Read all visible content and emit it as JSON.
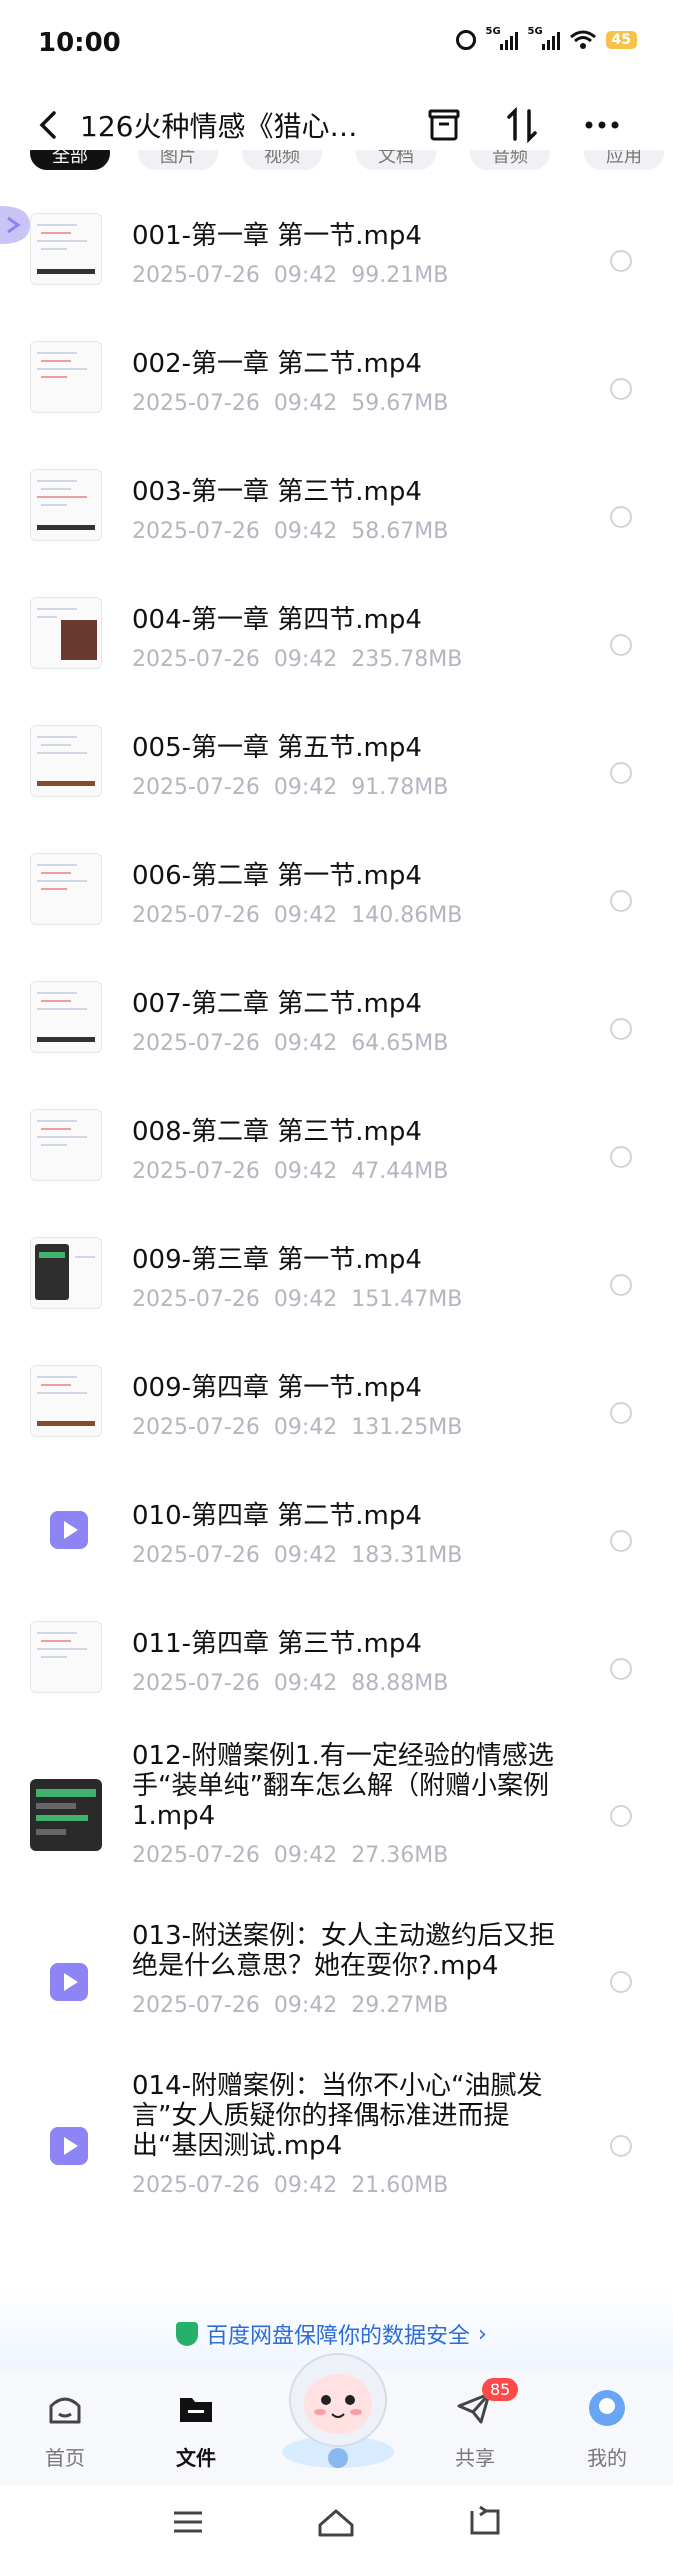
{
  "status": {
    "time": "10:00",
    "network1": "5G",
    "network2": "5G",
    "battery": "45"
  },
  "header": {
    "title": "126火种情感《猎心…"
  },
  "chips": [
    "全部",
    "图片",
    "视频",
    "文档",
    "音频",
    "应用"
  ],
  "files": [
    {
      "name": "001-第一章 第一节.mp4",
      "date": "2025-07-26  09:42",
      "size": "99.21MB",
      "thumb": "doc"
    },
    {
      "name": "002-第一章 第二节.mp4",
      "date": "2025-07-26  09:42",
      "size": "59.67MB",
      "thumb": "doc"
    },
    {
      "name": "003-第一章 第三节.mp4",
      "date": "2025-07-26  09:42",
      "size": "58.67MB",
      "thumb": "doc"
    },
    {
      "name": "004-第一章 第四节.mp4",
      "date": "2025-07-26  09:42",
      "size": "235.78MB",
      "thumb": "doc-photo"
    },
    {
      "name": "005-第一章 第五节.mp4",
      "date": "2025-07-26  09:42",
      "size": "91.78MB",
      "thumb": "doc"
    },
    {
      "name": "006-第二章 第一节.mp4",
      "date": "2025-07-26  09:42",
      "size": "140.86MB",
      "thumb": "doc"
    },
    {
      "name": "007-第二章 第二节.mp4",
      "date": "2025-07-26  09:42",
      "size": "64.65MB",
      "thumb": "doc"
    },
    {
      "name": "008-第二章 第三节.mp4",
      "date": "2025-07-26  09:42",
      "size": "47.44MB",
      "thumb": "doc"
    },
    {
      "name": "009-第三章 第一节.mp4",
      "date": "2025-07-26  09:42",
      "size": "151.47MB",
      "thumb": "phone"
    },
    {
      "name": "009-第四章 第一节.mp4",
      "date": "2025-07-26  09:42",
      "size": "131.25MB",
      "thumb": "doc"
    },
    {
      "name": "010-第四章 第二节.mp4",
      "date": "2025-07-26  09:42",
      "size": "183.31MB",
      "thumb": "play"
    },
    {
      "name": "011-第四章 第三节.mp4",
      "date": "2025-07-26  09:42",
      "size": "88.88MB",
      "thumb": "doc"
    },
    {
      "name": "012-附赠案例1.有一定经验的情感选手“装单纯”翻车怎么解（附赠小案例1.mp4",
      "date": "2025-07-26  09:42",
      "size": "27.36MB",
      "thumb": "chat"
    },
    {
      "name": "013-附送案例：女人主动邀约后又拒绝是什么意思？她在耍你?.mp4",
      "date": "2025-07-26  09:42",
      "size": "29.27MB",
      "thumb": "play"
    },
    {
      "name": "014-附赠案例：当你不小心“油腻发言”女人质疑你的择偶标准进而提出“基因测试.mp4",
      "date": "2025-07-26  09:42",
      "size": "21.60MB",
      "thumb": "play"
    }
  ],
  "security_banner": "百度网盘保障你的数据安全",
  "tabs": [
    {
      "label": "首页",
      "icon": "home-icon"
    },
    {
      "label": "文件",
      "icon": "folder-icon"
    },
    {
      "label": "共享",
      "icon": "share-icon",
      "badge": "85"
    },
    {
      "label": "我的",
      "icon": "profile-icon"
    }
  ],
  "colors": {
    "accent": "#8d84f5",
    "banner_text": "#2d6bd8",
    "badge": "#ff4a4a"
  }
}
